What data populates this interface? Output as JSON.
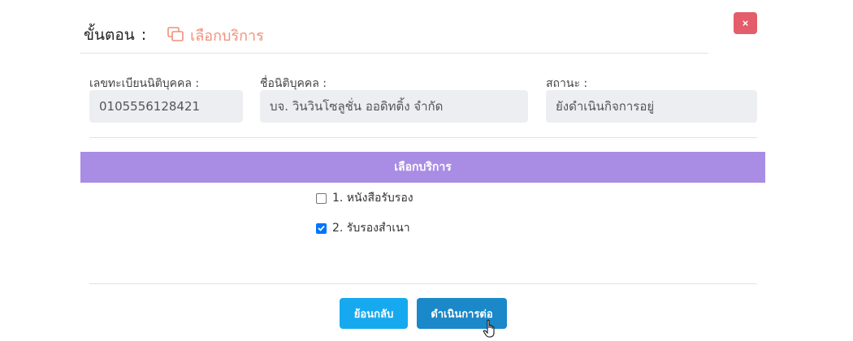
{
  "header": {
    "step_label": "ขั้นตอน",
    "colon": ":",
    "step_name": "เลือกบริการ",
    "step_icon": "copy-icon",
    "accent_color": "#f0907a"
  },
  "close_button": {
    "label": "×",
    "icon": "close-icon",
    "color": "#e35d6a"
  },
  "fields": [
    {
      "label": "เลขทะเบียนนิติบุคคล :",
      "value": "0105556128421"
    },
    {
      "label": "ชื่อนิติบุคคล :",
      "value": "บจ. วินวินโซลูชั่น ออดิทติ้ง จำกัด"
    },
    {
      "label": "สถานะ :",
      "value": "ยังดำเนินกิจการอยู่"
    }
  ],
  "services": {
    "title": "เลือกบริการ",
    "bar_color": "#a98de4",
    "options": [
      {
        "label": "1. หนังสือรับรอง",
        "checked": false
      },
      {
        "label": "2. รับรองสำเนา",
        "checked": true
      }
    ]
  },
  "buttons": {
    "back": "ย้อนกลับ",
    "next": "ดำเนินการต่อ"
  }
}
